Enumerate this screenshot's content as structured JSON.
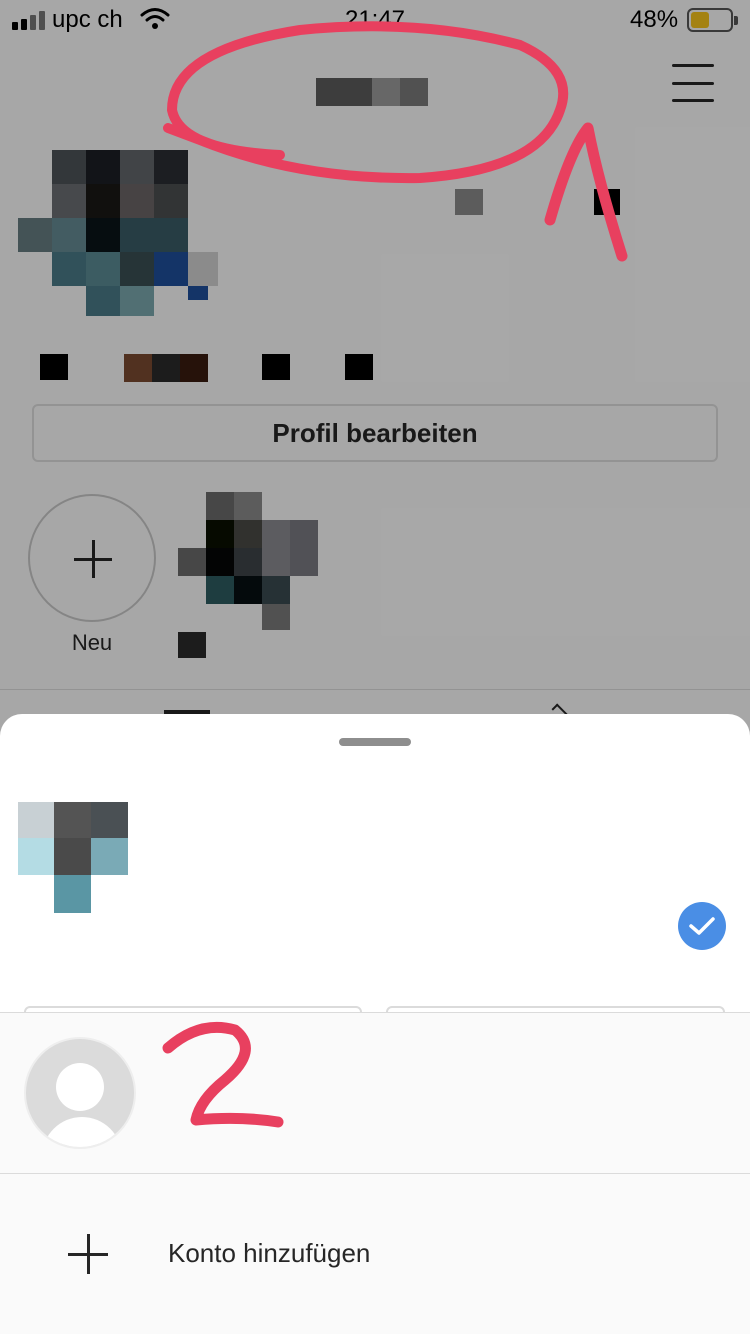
{
  "status_bar": {
    "carrier": "upc ch",
    "time": "21:47",
    "battery_percent": "48%",
    "battery_level": 0.48,
    "battery_color": "#f5c21b"
  },
  "profile": {
    "edit_profile_label": "Profil bearbeiten",
    "new_highlight_label": "Neu"
  },
  "sheet": {
    "add_account_label": "Konto hinzufügen"
  },
  "annotations": {
    "number_1": "1",
    "number_2": "2",
    "color": "#e8405f"
  },
  "colors": {
    "accent_blue": "#4a8ee5",
    "border": "#dbdbdb",
    "text": "#262626"
  },
  "icons": [
    "signal-icon",
    "wifi-icon",
    "battery-icon",
    "menu-icon",
    "plus-icon",
    "checkmark-icon",
    "default-avatar-icon"
  ]
}
